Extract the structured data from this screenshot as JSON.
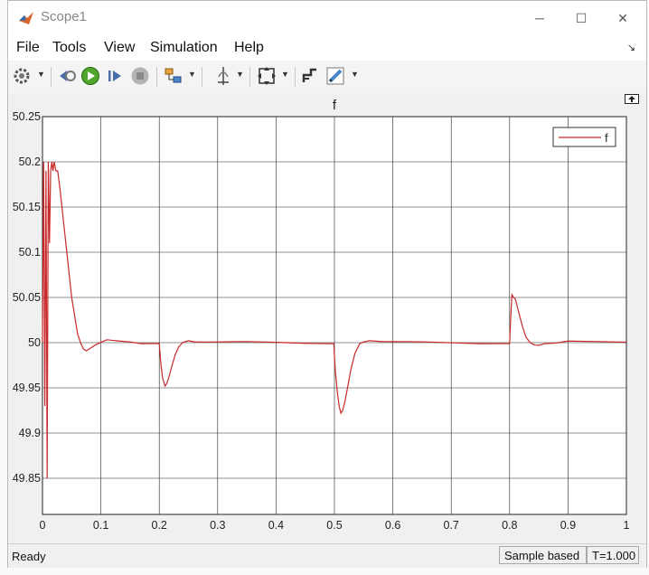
{
  "window": {
    "title": "Scope1",
    "minimize_glyph": "─",
    "maximize_glyph": "☐",
    "close_glyph": "✕"
  },
  "menu": {
    "items": [
      "File",
      "Tools",
      "View",
      "Simulation",
      "Help"
    ],
    "pin_glyph": "↘"
  },
  "toolbar": {
    "buttons": [
      "settings-icon",
      "step-back-icon",
      "run-icon",
      "step-forward-icon",
      "stop-icon",
      "highlight-icon",
      "cursor-measure-icon",
      "zoom-fit-icon",
      "style-icon",
      "edit-icon"
    ]
  },
  "status": {
    "ready": "Ready",
    "mode": "Sample based",
    "time": "T=1.000"
  },
  "colors": {
    "trace": "#c8282a",
    "plot_bg": "#ffffff",
    "grid": "#262626",
    "window_bg": "#f0f0f0"
  },
  "chart_data": {
    "type": "line",
    "title": "f",
    "xlabel": "",
    "ylabel": "",
    "xlim": [
      0,
      1
    ],
    "ylim": [
      49.81,
      50.25
    ],
    "x_ticks": [
      "0",
      "0.1",
      "0.2",
      "0.3",
      "0.4",
      "0.5",
      "0.6",
      "0.7",
      "0.8",
      "0.9",
      "1"
    ],
    "y_ticks": [
      "49.85",
      "49.9",
      "49.95",
      "50",
      "50.05",
      "50.1",
      "50.15",
      "50.2",
      "50.25"
    ],
    "grid": true,
    "legend_position": "top-right",
    "series": [
      {
        "name": "f",
        "x": [
          0,
          0.002,
          0.004,
          0.006,
          0.008,
          0.01,
          0.012,
          0.014,
          0.016,
          0.018,
          0.02,
          0.023,
          0.026,
          0.03,
          0.035,
          0.04,
          0.045,
          0.05,
          0.055,
          0.06,
          0.065,
          0.07,
          0.075,
          0.08,
          0.09,
          0.1,
          0.11,
          0.13,
          0.15,
          0.17,
          0.2,
          0.201,
          0.203,
          0.206,
          0.21,
          0.213,
          0.217,
          0.222,
          0.227,
          0.233,
          0.24,
          0.25,
          0.26,
          0.28,
          0.3,
          0.35,
          0.4,
          0.45,
          0.499,
          0.5,
          0.502,
          0.505,
          0.508,
          0.511,
          0.514,
          0.518,
          0.523,
          0.528,
          0.535,
          0.543,
          0.55,
          0.56,
          0.58,
          0.6,
          0.65,
          0.7,
          0.75,
          0.8,
          0.802,
          0.804,
          0.807,
          0.81,
          0.813,
          0.817,
          0.822,
          0.828,
          0.835,
          0.843,
          0.85,
          0.86,
          0.88,
          0.9,
          0.95,
          1.0
        ],
        "y": [
          50.0,
          50.2,
          49.93,
          50.19,
          49.85,
          50.2,
          50.11,
          50.19,
          50.2,
          50.19,
          50.2,
          50.19,
          50.19,
          50.17,
          50.14,
          50.11,
          50.08,
          50.05,
          50.03,
          50.01,
          49.999,
          49.993,
          49.991,
          49.993,
          49.998,
          50.0,
          50.002,
          50.001,
          50.001,
          50.0,
          50.0,
          49.99,
          49.975,
          49.96,
          49.952,
          49.955,
          49.963,
          49.975,
          49.986,
          49.995,
          50.0,
          50.003,
          50.002,
          50.001,
          50.0,
          50.0,
          50.0,
          50.0,
          50.0,
          49.985,
          49.965,
          49.945,
          49.93,
          49.922,
          49.925,
          49.935,
          49.952,
          49.97,
          49.988,
          49.999,
          50.002,
          50.003,
          50.001,
          50.0,
          50.0,
          50.0,
          50.0,
          50.0,
          50.03,
          50.053,
          50.05,
          50.048,
          50.04,
          50.03,
          50.018,
          50.006,
          49.999,
          49.997,
          49.998,
          50.0,
          50.0,
          50.001,
          50.0,
          50.0
        ]
      }
    ]
  }
}
